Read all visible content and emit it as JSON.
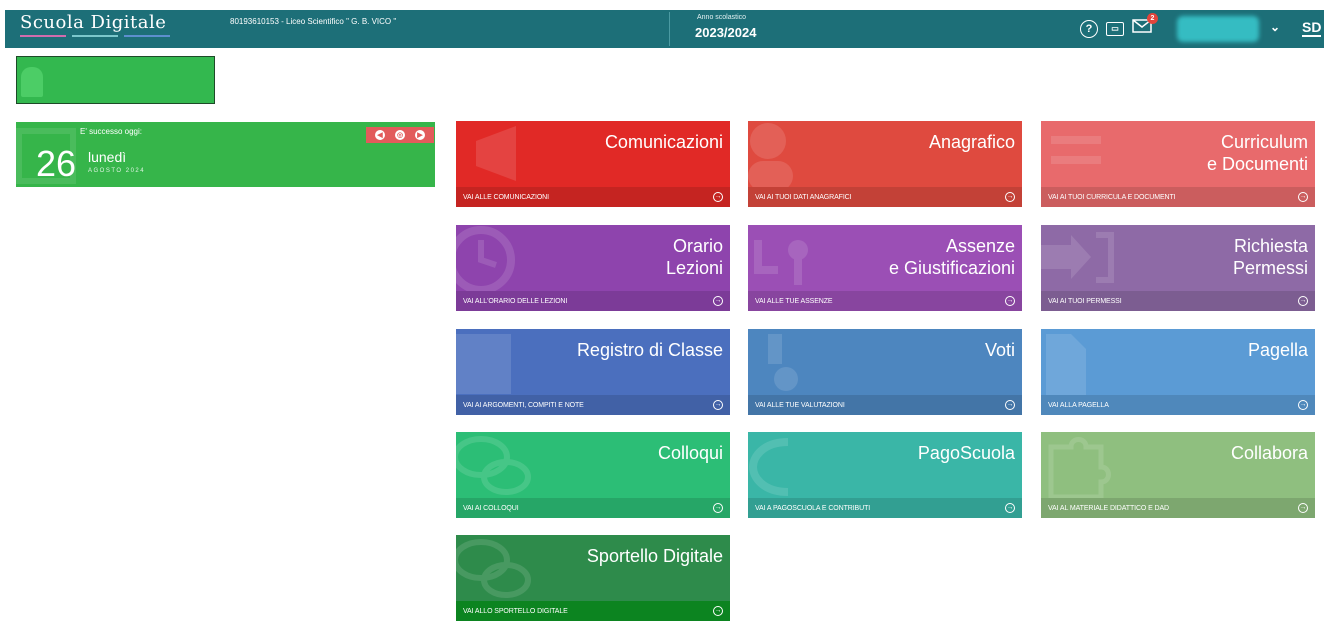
{
  "header": {
    "brand": "Scuola Digitale",
    "brand_colors": [
      "#d16cae",
      "#7bc7cc",
      "#5d8fce"
    ],
    "school": "80193610153 - Liceo Scientifico \" G. B. VICO \"",
    "year_caption": "Anno scolastico",
    "year_value": "2023/2024",
    "help_icon": "?",
    "card_icon": "card-icon",
    "mail_badge": "2",
    "user_initials": "SD",
    "chevron": "chevron-down-icon"
  },
  "today": {
    "caption": "E' successo oggi:",
    "day": "26",
    "weekday": "lunedì",
    "month": "AGOSTO 2024",
    "nav": [
      "◀",
      "◎",
      "▶"
    ]
  },
  "tiles": [
    {
      "title": "Comunicazioni",
      "link": "VAI ALLE COMUNICAZIONI",
      "color": "#e12926"
    },
    {
      "title": "Anagrafico",
      "link": "VAI AI TUOI DATI ANAGRAFICI",
      "color": "#df4a3f"
    },
    {
      "title": "Curriculum\ne Documenti",
      "link": "VAI AI TUOI CURRICULA E DOCUMENTI",
      "color": "#e86a6c"
    },
    {
      "title": "Orario\nLezioni",
      "link": "VAI ALL'ORARIO DELLE LEZIONI",
      "color": "#8e44ad"
    },
    {
      "title": "Assenze\ne Giustificazioni",
      "link": "VAI ALLE TUE ASSENZE",
      "color": "#9b4fb5"
    },
    {
      "title": "Richiesta\nPermessi",
      "link": "VAI AI TUOI PERMESSI",
      "color": "#8e6aa6"
    },
    {
      "title": "Registro di Classe",
      "link": "VAI AI ARGOMENTI, COMPITI E NOTE",
      "color": "#4b6fbe"
    },
    {
      "title": "Voti",
      "link": "VAI ALLE TUE VALUTAZIONI",
      "color": "#4d86bf"
    },
    {
      "title": "Pagella",
      "link": "VAI ALLA PAGELLA",
      "color": "#5b9bd5"
    },
    {
      "title": "Colloqui",
      "link": "VAI AI COLLOQUI",
      "color": "#2cbe76"
    },
    {
      "title": "PagoScuola",
      "link": "VAI A PAGOSCUOLA E CONTRIBUTI",
      "color": "#3ab6a7"
    },
    {
      "title": "Collabora",
      "link": "VAI AL MATERIALE DIDATTICO E DAD",
      "color": "#8fbf7f"
    },
    {
      "title": "Sportello Digitale",
      "link": "VAI ALLO SPORTELLO DIGITALE",
      "color": "#2e8b4b"
    }
  ]
}
